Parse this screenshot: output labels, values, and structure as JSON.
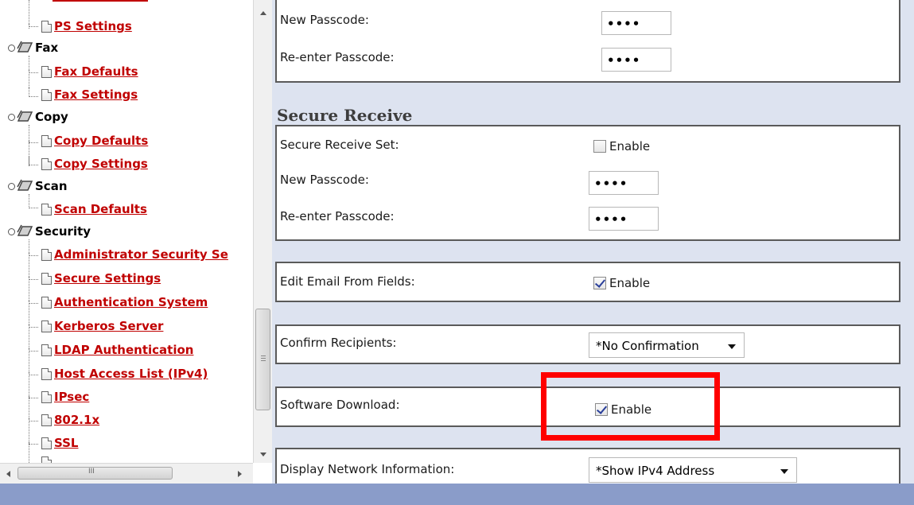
{
  "tree": {
    "items": [
      {
        "type": "link",
        "label": "PS Settings"
      },
      {
        "type": "folder",
        "label": "Fax"
      },
      {
        "type": "link",
        "label": "Fax Defaults"
      },
      {
        "type": "link",
        "label": "Fax Settings"
      },
      {
        "type": "folder",
        "label": "Copy"
      },
      {
        "type": "link",
        "label": "Copy Defaults"
      },
      {
        "type": "link",
        "label": "Copy Settings"
      },
      {
        "type": "folder",
        "label": "Scan"
      },
      {
        "type": "link",
        "label": "Scan Defaults"
      },
      {
        "type": "folder",
        "label": "Security"
      },
      {
        "type": "link",
        "label": "Administrator Security Se"
      },
      {
        "type": "link",
        "label": "Secure Settings"
      },
      {
        "type": "link",
        "label": "Authentication System"
      },
      {
        "type": "link",
        "label": "Kerberos Server"
      },
      {
        "type": "link",
        "label": "LDAP Authentication"
      },
      {
        "type": "link",
        "label": "Host Access List (IPv4)"
      },
      {
        "type": "link",
        "label": "IPsec"
      },
      {
        "type": "link",
        "label": "802.1x"
      },
      {
        "type": "link",
        "label": "SSL"
      }
    ],
    "hscroll_grip": "III"
  },
  "content": {
    "top_panel": {
      "new_passcode_label": "New Passcode:",
      "new_passcode_value": "••••",
      "reenter_label": "Re-enter Passcode:",
      "reenter_value": "••••"
    },
    "secure_receive": {
      "title": "Secure Receive",
      "set_label": "Secure Receive Set:",
      "set_checkbox": "Enable",
      "set_checked": false,
      "new_passcode_label": "New Passcode:",
      "new_passcode_value": "••••",
      "reenter_label": "Re-enter Passcode:",
      "reenter_value": "••••"
    },
    "edit_email": {
      "label": "Edit Email From Fields:",
      "checkbox": "Enable",
      "checked": true
    },
    "confirm_recipients": {
      "label": "Confirm Recipients:",
      "selected": "*No Confirmation"
    },
    "software_download": {
      "label": "Software Download:",
      "checkbox": "Enable",
      "checked": true
    },
    "display_network": {
      "label": "Display Network Information:",
      "selected": "*Show IPv4 Address"
    }
  },
  "colors": {
    "link": "#c00000",
    "content_bg": "#dde3f0",
    "highlight": "#ff0000",
    "status_bar": "#8a9cc9"
  }
}
